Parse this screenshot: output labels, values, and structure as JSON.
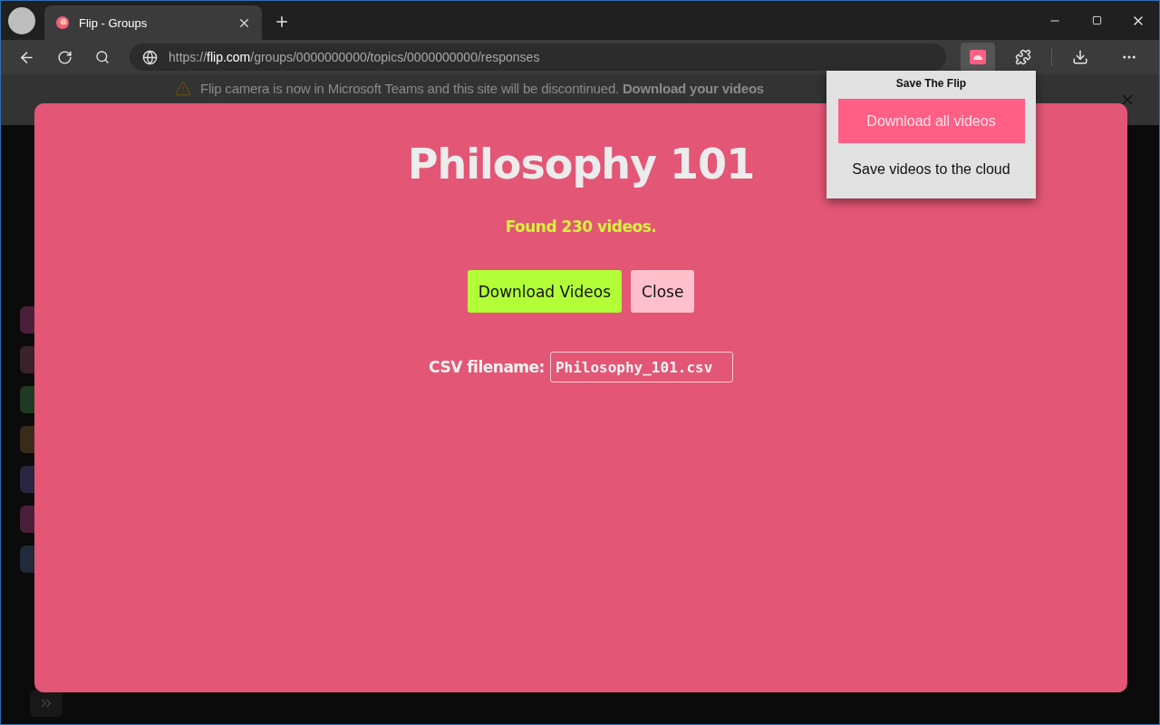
{
  "browser": {
    "tabs": [
      {
        "title": "Flip - Groups",
        "selected": true
      }
    ],
    "address": {
      "scheme": "https://",
      "host": "flip.com",
      "path": "/groups/0000000000/topics/0000000000/responses"
    }
  },
  "banner": {
    "text": "Flip camera is now in Microsoft Teams and this site will be discontinued. **Download your videos**"
  },
  "modal": {
    "title": "Philosophy 101",
    "status": "Found 230 videos.",
    "buttons": [
      {
        "label": "Download Videos",
        "kind": "primary"
      },
      {
        "label": "Close",
        "kind": "secondary"
      }
    ],
    "csv": {
      "label": "CSV filename:",
      "value": "Philosophy_101.csv"
    }
  },
  "popup": {
    "title": "Save The Flip",
    "actions": [
      {
        "label": "Download all videos",
        "kind": "primary"
      },
      {
        "label": "Save videos to the cloud",
        "kind": "plain"
      }
    ]
  }
}
